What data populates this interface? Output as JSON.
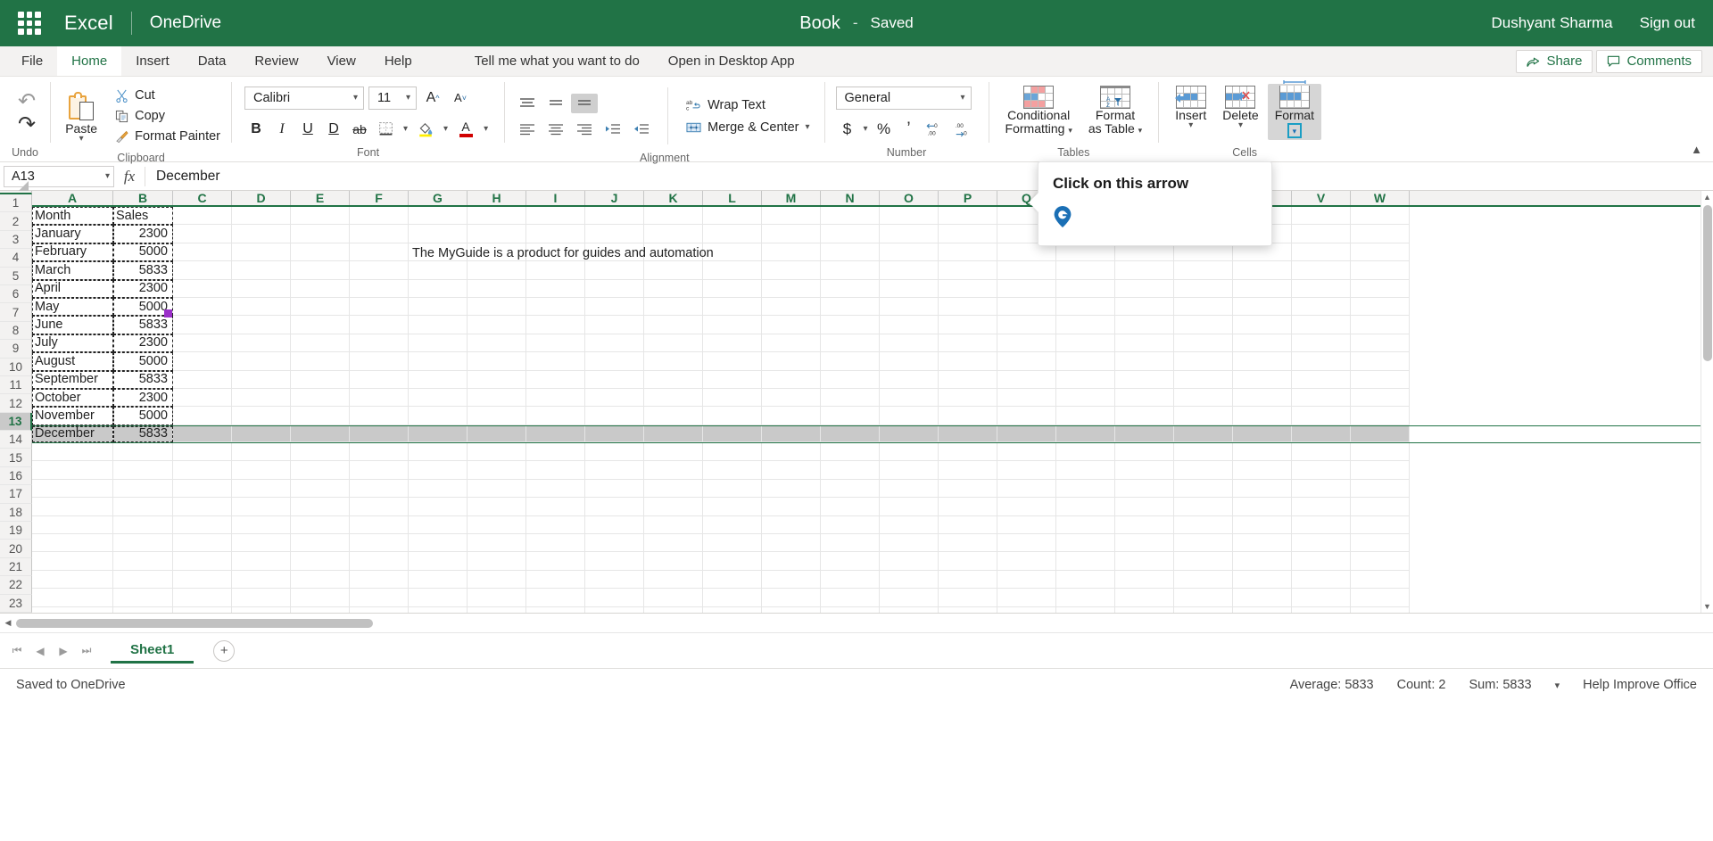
{
  "titlebar": {
    "app_name": "Excel",
    "location": "OneDrive",
    "doc_title": "Book",
    "doc_dash": "-",
    "doc_status": "Saved",
    "user_name": "Dushyant Sharma",
    "sign_out": "Sign out"
  },
  "tabs": [
    {
      "label": "File",
      "active": false
    },
    {
      "label": "Home",
      "active": true
    },
    {
      "label": "Insert",
      "active": false
    },
    {
      "label": "Data",
      "active": false
    },
    {
      "label": "Review",
      "active": false
    },
    {
      "label": "View",
      "active": false
    },
    {
      "label": "Help",
      "active": false
    }
  ],
  "tab_extras": {
    "tell_me": "Tell me what you want to do",
    "open_desktop": "Open in Desktop App",
    "share": "Share",
    "comments": "Comments"
  },
  "ribbon": {
    "undo_label": "Undo",
    "clipboard": {
      "group_label": "Clipboard",
      "paste": "Paste",
      "cut": "Cut",
      "copy": "Copy",
      "format_painter": "Format Painter"
    },
    "font": {
      "group_label": "Font",
      "font_name": "Calibri",
      "font_size": "11",
      "grow": "A",
      "shrink": "A",
      "bold": "B",
      "italic": "I",
      "underline": "U",
      "double_underline": "D",
      "strikethrough": "ab",
      "borders": "borders",
      "fill_color": "fill",
      "font_color": "A"
    },
    "alignment": {
      "group_label": "Alignment",
      "wrap_text": "Wrap Text",
      "merge_center": "Merge & Center"
    },
    "number": {
      "group_label": "Number",
      "format": "General",
      "currency": "$",
      "percent": "%",
      "comma": "’",
      "increase_decimal": "increase-decimal",
      "decrease_decimal": "decrease-decimal"
    },
    "tables": {
      "group_label": "Tables",
      "conditional_formatting": "Conditional\nFormatting",
      "conditional_formatting_l1": "Conditional",
      "conditional_formatting_l2": "Formatting",
      "format_as_table_l1": "Format",
      "format_as_table_l2": "as Table"
    },
    "cells": {
      "group_label": "Cells",
      "insert": "Insert",
      "delete": "Delete",
      "format": "Format"
    }
  },
  "coach": {
    "title": "Click on this arrow",
    "pin_color": "#1a6fb5"
  },
  "formula_bar": {
    "name_box": "A13",
    "fx": "fx",
    "formula_value": "December"
  },
  "grid": {
    "columns": [
      "A",
      "B",
      "C",
      "D",
      "E",
      "F",
      "G",
      "H",
      "I",
      "J",
      "K",
      "L",
      "M",
      "N",
      "O",
      "P",
      "Q",
      "R",
      "S",
      "T",
      "U",
      "V",
      "W"
    ],
    "selected_row": 13,
    "selected_cell": "A13",
    "overflow_cell": {
      "row": 3,
      "col": "G",
      "text": "The MyGuide is a product for guides and automation"
    },
    "rows": [
      {
        "n": 1,
        "a": "Month",
        "b": "Sales"
      },
      {
        "n": 2,
        "a": "January",
        "b": "2300"
      },
      {
        "n": 3,
        "a": "February",
        "b": "5000"
      },
      {
        "n": 4,
        "a": "March",
        "b": "5833"
      },
      {
        "n": 5,
        "a": "April",
        "b": "2300"
      },
      {
        "n": 6,
        "a": "May",
        "b": "5000"
      },
      {
        "n": 7,
        "a": "June",
        "b": "5833"
      },
      {
        "n": 8,
        "a": "July",
        "b": "2300"
      },
      {
        "n": 9,
        "a": "August",
        "b": "5000"
      },
      {
        "n": 10,
        "a": "September",
        "b": "5833"
      },
      {
        "n": 11,
        "a": "October",
        "b": "2300"
      },
      {
        "n": 12,
        "a": "November",
        "b": "5000"
      },
      {
        "n": 13,
        "a": "December",
        "b": "5833"
      },
      {
        "n": 14,
        "a": "",
        "b": ""
      },
      {
        "n": 15,
        "a": "",
        "b": ""
      },
      {
        "n": 16,
        "a": "",
        "b": ""
      },
      {
        "n": 17,
        "a": "",
        "b": ""
      },
      {
        "n": 18,
        "a": "",
        "b": ""
      },
      {
        "n": 19,
        "a": "",
        "b": ""
      },
      {
        "n": 20,
        "a": "",
        "b": ""
      },
      {
        "n": 21,
        "a": "",
        "b": ""
      },
      {
        "n": 22,
        "a": "",
        "b": ""
      },
      {
        "n": 23,
        "a": "",
        "b": ""
      }
    ]
  },
  "sheetbar": {
    "sheet_name": "Sheet1",
    "add_sheet": "+"
  },
  "statusbar": {
    "saved_text": "Saved to OneDrive",
    "average": "Average: 5833",
    "count": "Count: 2",
    "sum": "Sum: 5833",
    "help_improve": "Help Improve Office"
  },
  "colors": {
    "brand_green": "#217346",
    "selection_gray": "#c9c9c9"
  }
}
